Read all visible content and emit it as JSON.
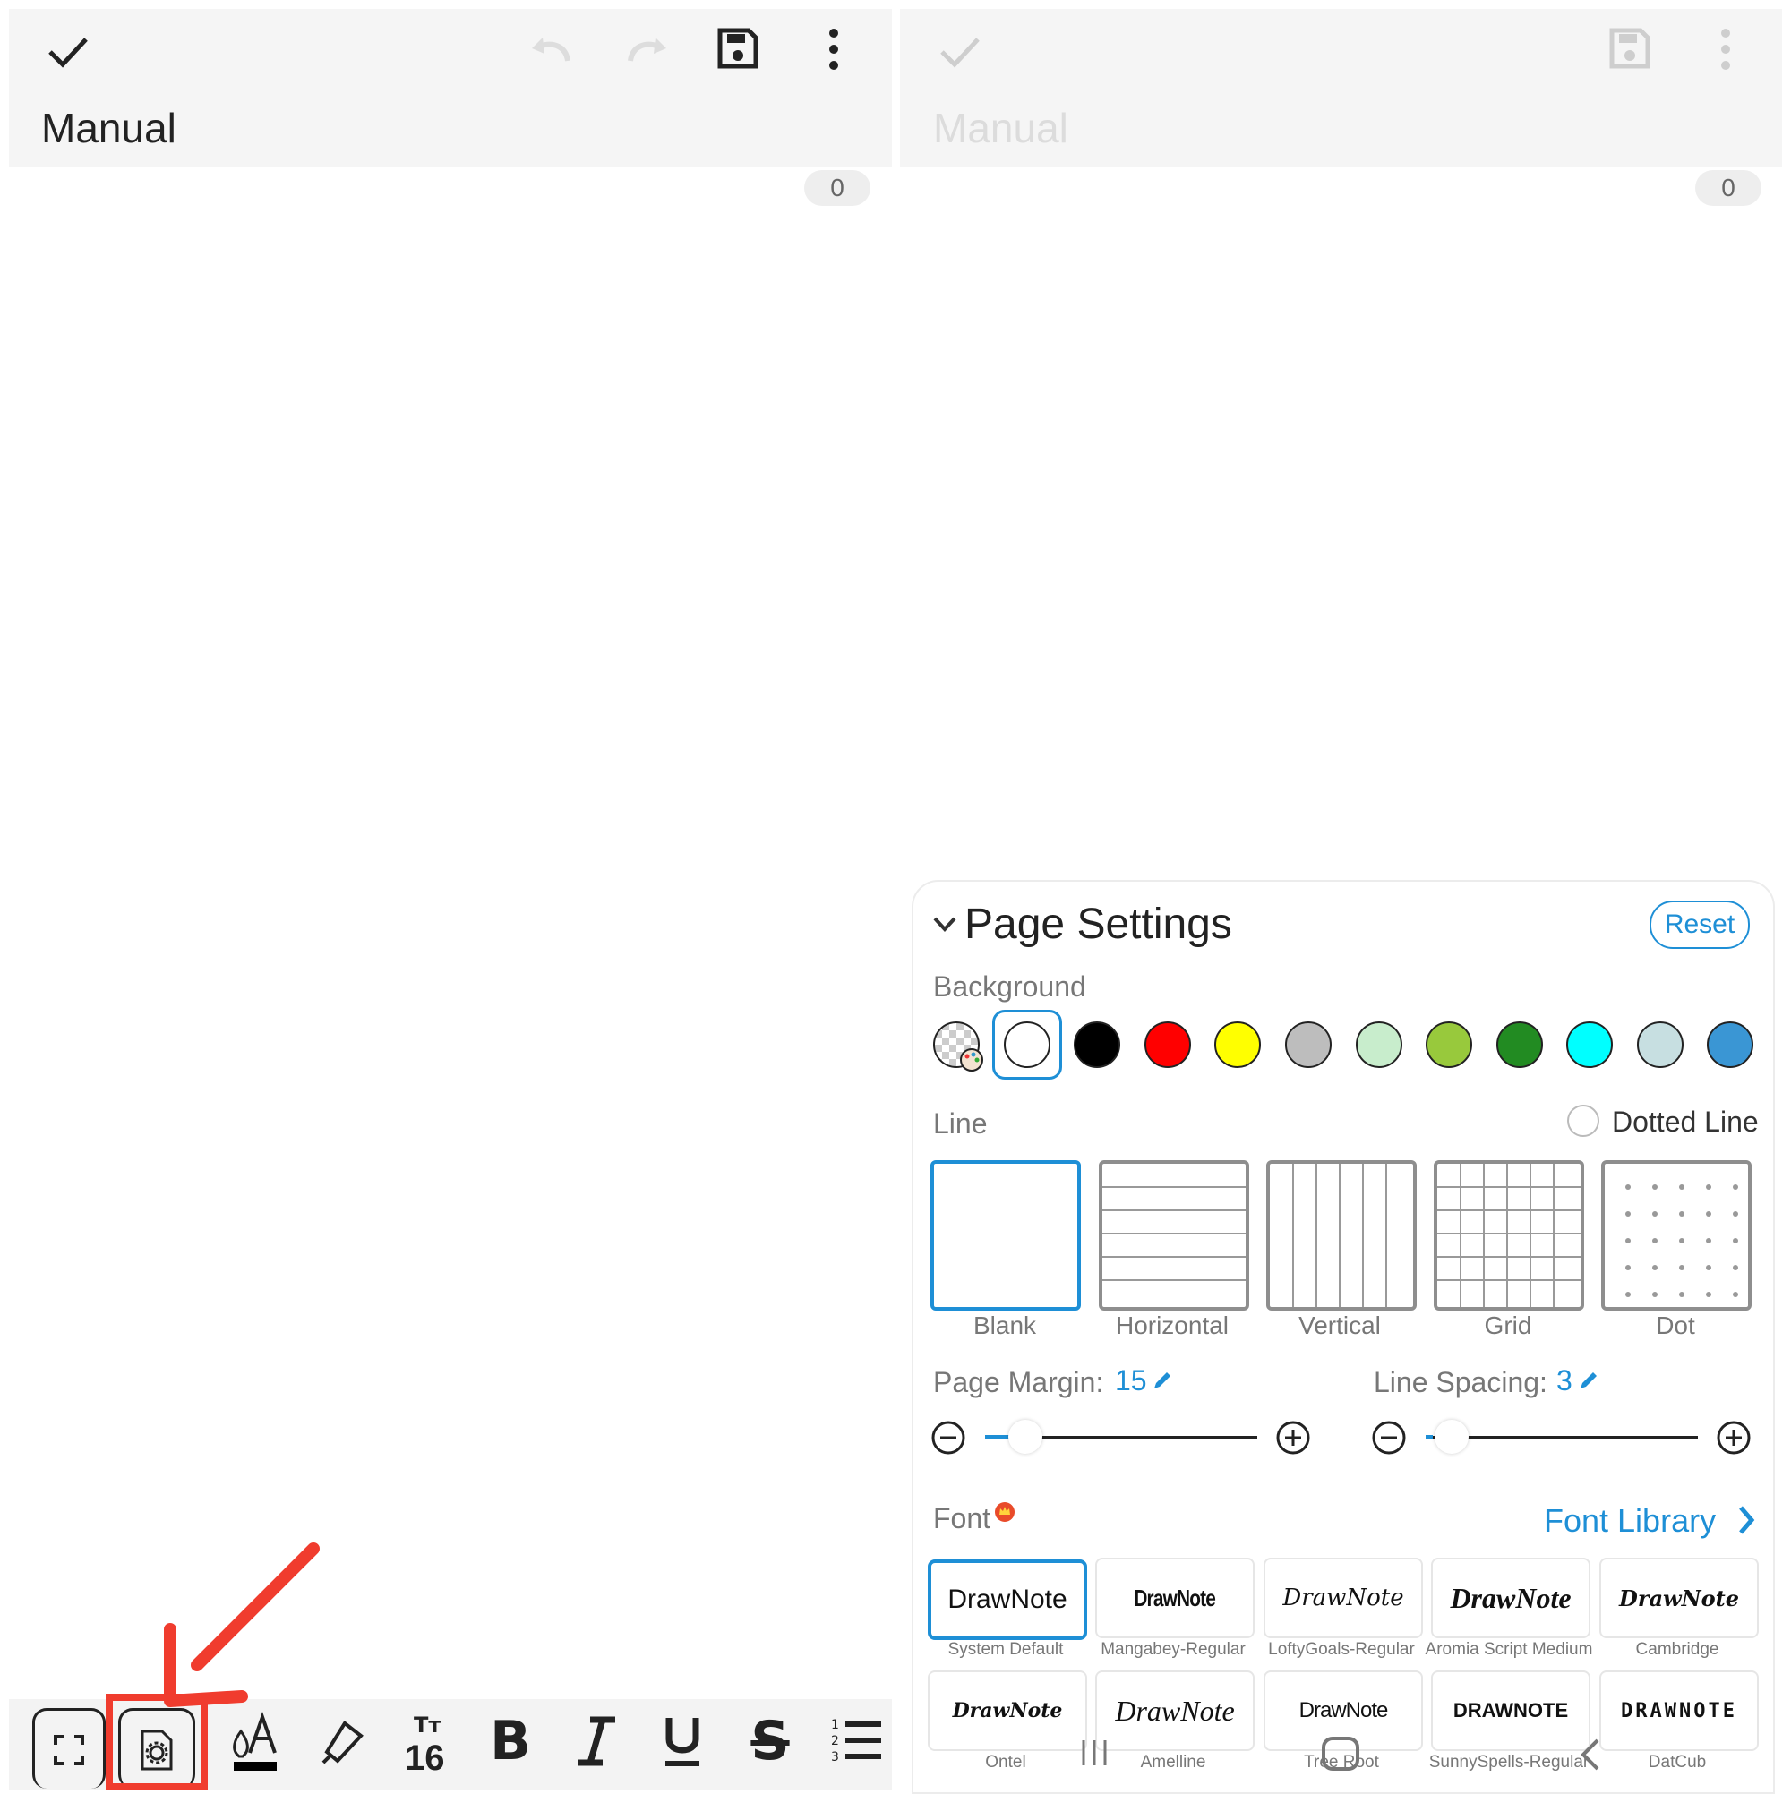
{
  "left_screen": {
    "title": "Manual",
    "char_count": "0"
  },
  "right_screen": {
    "title": "Manual",
    "char_count": "0"
  },
  "toolbar": {
    "font_size": "16",
    "items": [
      "fullscreen-icon",
      "page-settings-icon",
      "text-color-icon",
      "highlighter-icon",
      "font-size-icon",
      "bold-icon",
      "italic-icon",
      "underline-icon",
      "strikethrough-icon",
      "numbered-list-icon"
    ]
  },
  "page_settings": {
    "title": "Page Settings",
    "reset_label": "Reset",
    "background_label": "Background",
    "background_colors": [
      "#ffffff",
      "#000000",
      "#ff0000",
      "#ffff00",
      "#bdbdbd",
      "#c8edcc",
      "#98c93c",
      "#228b22",
      "#00ffff",
      "#c7dfe1",
      "#3a96d4"
    ],
    "selected_background": "#ffffff",
    "line_label": "Line",
    "dotted_line_label": "Dotted Line",
    "dotted_line_checked": false,
    "line_options": [
      "Blank",
      "Horizontal",
      "Vertical",
      "Grid",
      "Dot"
    ],
    "selected_line": "Blank",
    "page_margin_label": "Page Margin:",
    "page_margin_value": "15",
    "line_spacing_label": "Line Spacing:",
    "line_spacing_value": "3",
    "font_label": "Font",
    "font_library_label": "Font Library",
    "fonts": [
      {
        "sample": "DrawNote",
        "name": "System Default"
      },
      {
        "sample": "DrawNote",
        "name": "Mangabey-Regular"
      },
      {
        "sample": "DrawNote",
        "name": "LoftyGoals-Regular"
      },
      {
        "sample": "DrawNote",
        "name": "Aromia Script Medium"
      },
      {
        "sample": "DrawNote",
        "name": "Cambridge"
      },
      {
        "sample": "DrawNote",
        "name": "Ontel"
      },
      {
        "sample": "DrawNote",
        "name": "Amelline"
      },
      {
        "sample": "DrawNote",
        "name": "Tree Root"
      },
      {
        "sample": "DRAWNOTE",
        "name": "SunnySpells-Regular"
      },
      {
        "sample": "DRAWNOTE",
        "name": "DatCub"
      }
    ],
    "selected_font": "System Default"
  },
  "colors": {
    "accent": "#1e8fd6",
    "annotation": "#f03c2e"
  }
}
